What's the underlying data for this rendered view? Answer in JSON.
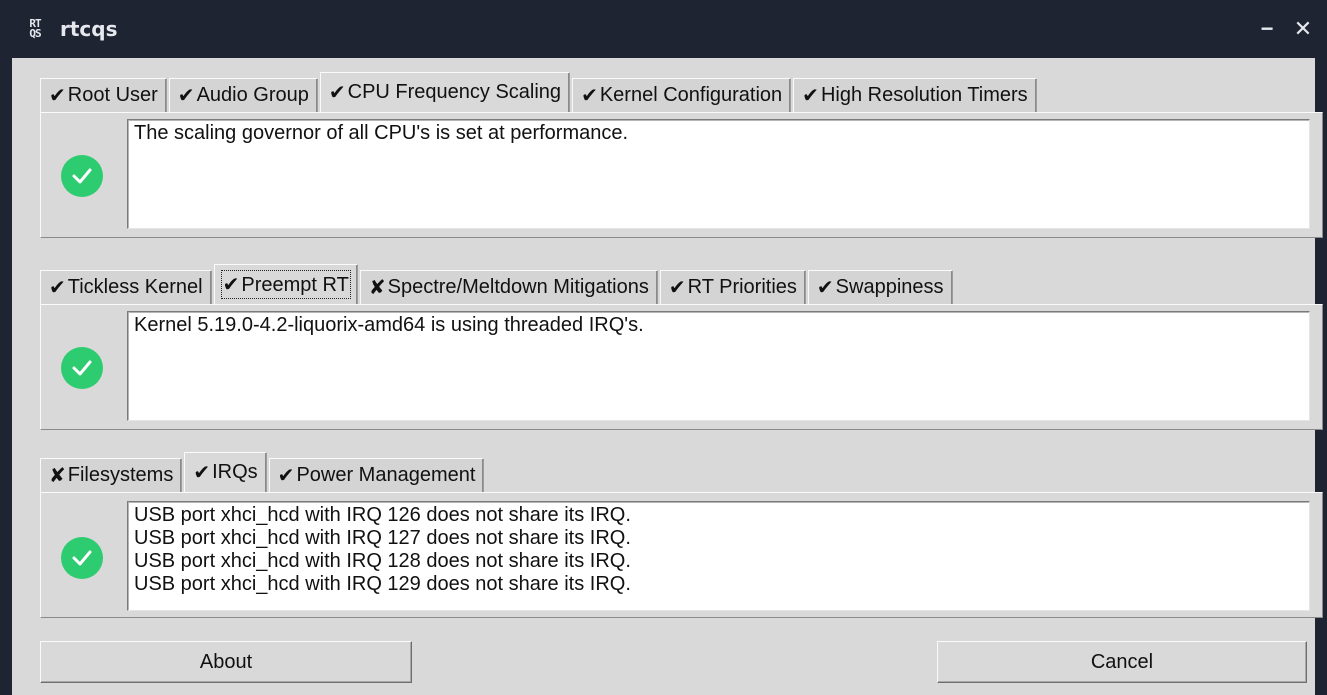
{
  "window": {
    "title": "rtcqs",
    "minimize_label": "−",
    "close_label": "✕"
  },
  "icons": {
    "check": "✔",
    "cross": "✘"
  },
  "sections": [
    {
      "tabs": [
        {
          "mark": "✔",
          "label": "Root User"
        },
        {
          "mark": "✔",
          "label": "Audio Group"
        },
        {
          "mark": "✔",
          "label": "CPU Frequency Scaling"
        },
        {
          "mark": "✔",
          "label": "Kernel Configuration"
        },
        {
          "mark": "✔",
          "label": "High Resolution Timers"
        }
      ],
      "active_tab": "CPU Frequency Scaling",
      "status": "ok",
      "lines": [
        "The scaling governor of all CPU's is set at performance."
      ]
    },
    {
      "tabs": [
        {
          "mark": "✔",
          "label": "Tickless Kernel"
        },
        {
          "mark": "✔",
          "label": "Preempt RT"
        },
        {
          "mark": "✘",
          "label": "Spectre/Meltdown Mitigations"
        },
        {
          "mark": "✔",
          "label": "RT Priorities"
        },
        {
          "mark": "✔",
          "label": "Swappiness"
        }
      ],
      "active_tab": "Preempt RT",
      "status": "ok",
      "lines": [
        "Kernel 5.19.0-4.2-liquorix-amd64 is using threaded IRQ's."
      ]
    },
    {
      "tabs": [
        {
          "mark": "✘",
          "label": "Filesystems"
        },
        {
          "mark": "✔",
          "label": "IRQs"
        },
        {
          "mark": "✔",
          "label": "Power Management"
        }
      ],
      "active_tab": "IRQs",
      "status": "ok",
      "lines": [
        "USB port xhci_hcd with IRQ 126 does not share its IRQ.",
        "USB port xhci_hcd with IRQ 127 does not share its IRQ.",
        "USB port xhci_hcd with IRQ 128 does not share its IRQ.",
        "USB port xhci_hcd with IRQ 129 does not share its IRQ."
      ]
    }
  ],
  "buttons": {
    "about": "About",
    "cancel": "Cancel"
  },
  "colors": {
    "status_ok": "#2ecc71",
    "titlebar": "#1e2432",
    "window_bg": "#d9d9d9"
  }
}
